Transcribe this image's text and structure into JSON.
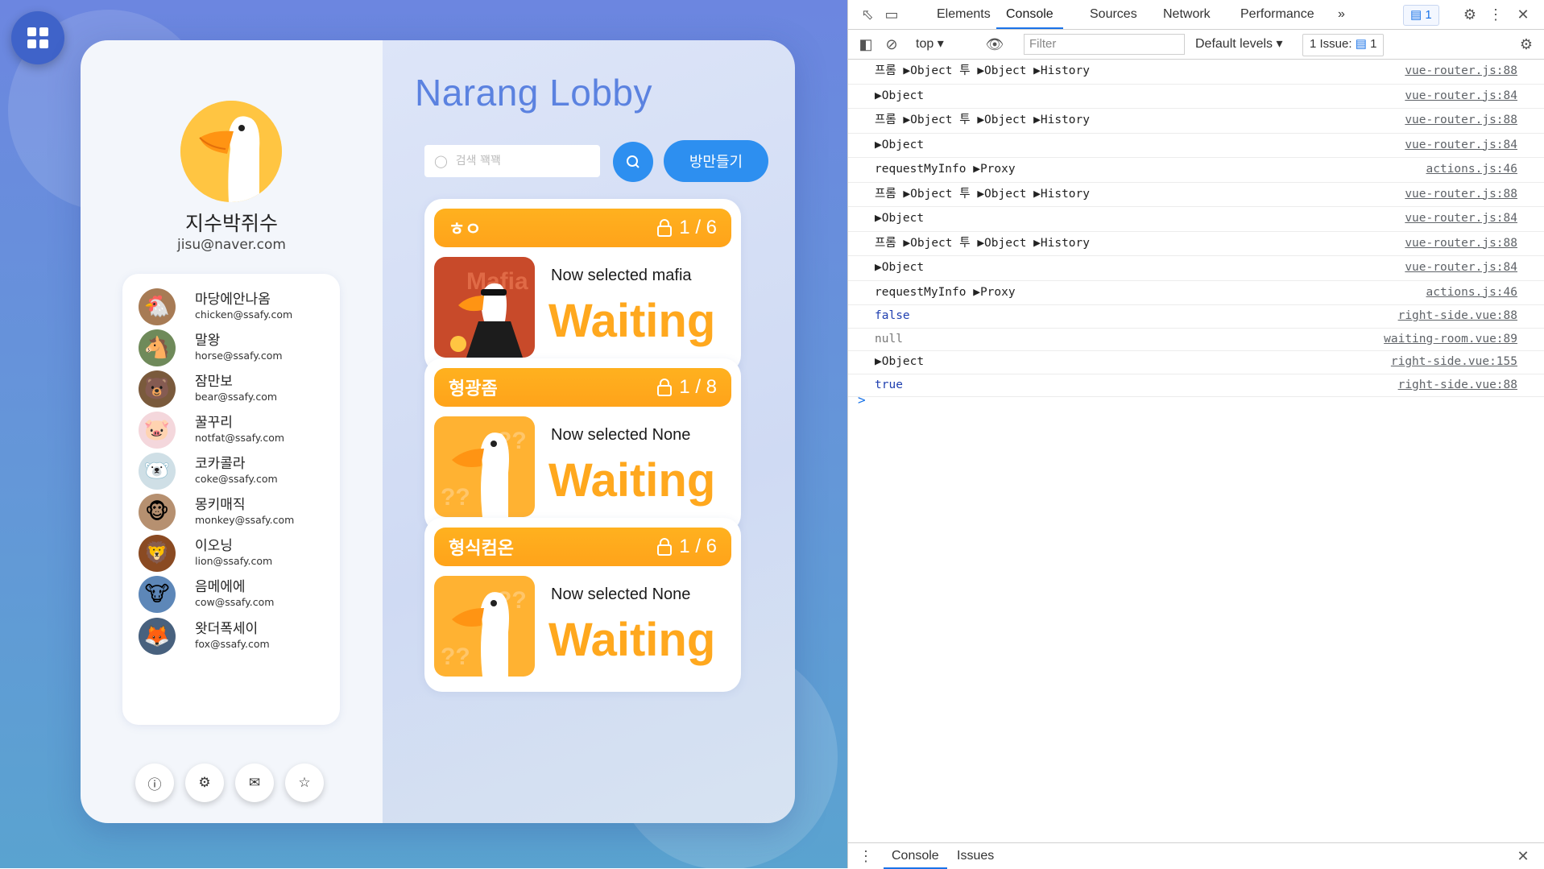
{
  "app": {
    "lobby_title": "Narang Lobby",
    "profile": {
      "name": "지수박쥐수",
      "email": "jisu@naver.com"
    },
    "search": {
      "placeholder": "검색 꽥꽥",
      "value": ""
    },
    "create_room_label": "방만들기",
    "friends": [
      {
        "name": "마당에안나옴",
        "email": "chicken@ssafy.com",
        "icon": "🐔",
        "bg": "#a77b55"
      },
      {
        "name": "말왕",
        "email": "horse@ssafy.com",
        "icon": "🐴",
        "bg": "#6f8a5a"
      },
      {
        "name": "잠만보",
        "email": "bear@ssafy.com",
        "icon": "🐻",
        "bg": "#7a5a3c"
      },
      {
        "name": "꿀꾸리",
        "email": "notfat@ssafy.com",
        "icon": "🐷",
        "bg": "#f4d7dc"
      },
      {
        "name": "코카콜라",
        "email": "coke@ssafy.com",
        "icon": "🐻‍❄️",
        "bg": "#cfdfe6"
      },
      {
        "name": "몽키매직",
        "email": "monkey@ssafy.com",
        "icon": "🐵",
        "bg": "#b69070"
      },
      {
        "name": "이오닝",
        "email": "lion@ssafy.com",
        "icon": "🦁",
        "bg": "#8a4a22"
      },
      {
        "name": "음메에에",
        "email": "cow@ssafy.com",
        "icon": "🐮",
        "bg": "#5d87b8"
      },
      {
        "name": "왓더폭세이",
        "email": "fox@ssafy.com",
        "icon": "🦊",
        "bg": "#48617e"
      }
    ],
    "rooms": [
      {
        "title": "ㅎㅇ",
        "count": "1 / 6",
        "selected": "Now selected mafia",
        "status": "Waiting",
        "theme": "mafia"
      },
      {
        "title": "형광좀",
        "count": "1 / 8",
        "selected": "Now selected None",
        "status": "Waiting",
        "theme": "goose"
      },
      {
        "title": "형식컴온",
        "count": "1 / 6",
        "selected": "Now selected None",
        "status": "Waiting",
        "theme": "goose"
      }
    ],
    "thumb_text": {
      "mafia": "Mafia",
      "question": "??"
    }
  },
  "devtools": {
    "tabs": [
      "Elements",
      "Console",
      "Sources",
      "Network",
      "Performance"
    ],
    "active_tab": "Console",
    "more_tabs": "»",
    "message_count": "1",
    "context": "top",
    "filter_placeholder": "Filter",
    "levels": "Default levels",
    "issues_label": "1 Issue:",
    "issues_count": "1",
    "logs": [
      {
        "msg": "프롬 ▶Object 투 ▶Object ▶History",
        "src": "vue-router.js:88"
      },
      {
        "msg": "▶Object",
        "src": "vue-router.js:84"
      },
      {
        "msg": "프롬 ▶Object 투 ▶Object ▶History",
        "src": "vue-router.js:88"
      },
      {
        "msg": "▶Object",
        "src": "vue-router.js:84"
      },
      {
        "msg": "requestMyInfo ▶Proxy",
        "src": "actions.js:46"
      },
      {
        "msg": "프롬 ▶Object 투 ▶Object ▶History",
        "src": "vue-router.js:88"
      },
      {
        "msg": "▶Object",
        "src": "vue-router.js:84"
      },
      {
        "msg": "프롬 ▶Object 투 ▶Object ▶History",
        "src": "vue-router.js:88"
      },
      {
        "msg": "▶Object",
        "src": "vue-router.js:84"
      },
      {
        "msg": "requestMyInfo ▶Proxy",
        "src": "actions.js:46"
      },
      {
        "msg": "false",
        "src": "right-side.vue:88",
        "kind": "kw"
      },
      {
        "msg": "null",
        "src": "waiting-room.vue:89",
        "kind": "nl"
      },
      {
        "msg": "▶Object",
        "src": "right-side.vue:155"
      },
      {
        "msg": "true",
        "src": "right-side.vue:88",
        "kind": "kw"
      }
    ],
    "prompt": ">",
    "drawer_tabs": [
      "Console",
      "Issues"
    ]
  },
  "colors": {
    "accent": "#2d8ff0",
    "room_header": "#ffa31a",
    "title": "#5b82e0"
  }
}
